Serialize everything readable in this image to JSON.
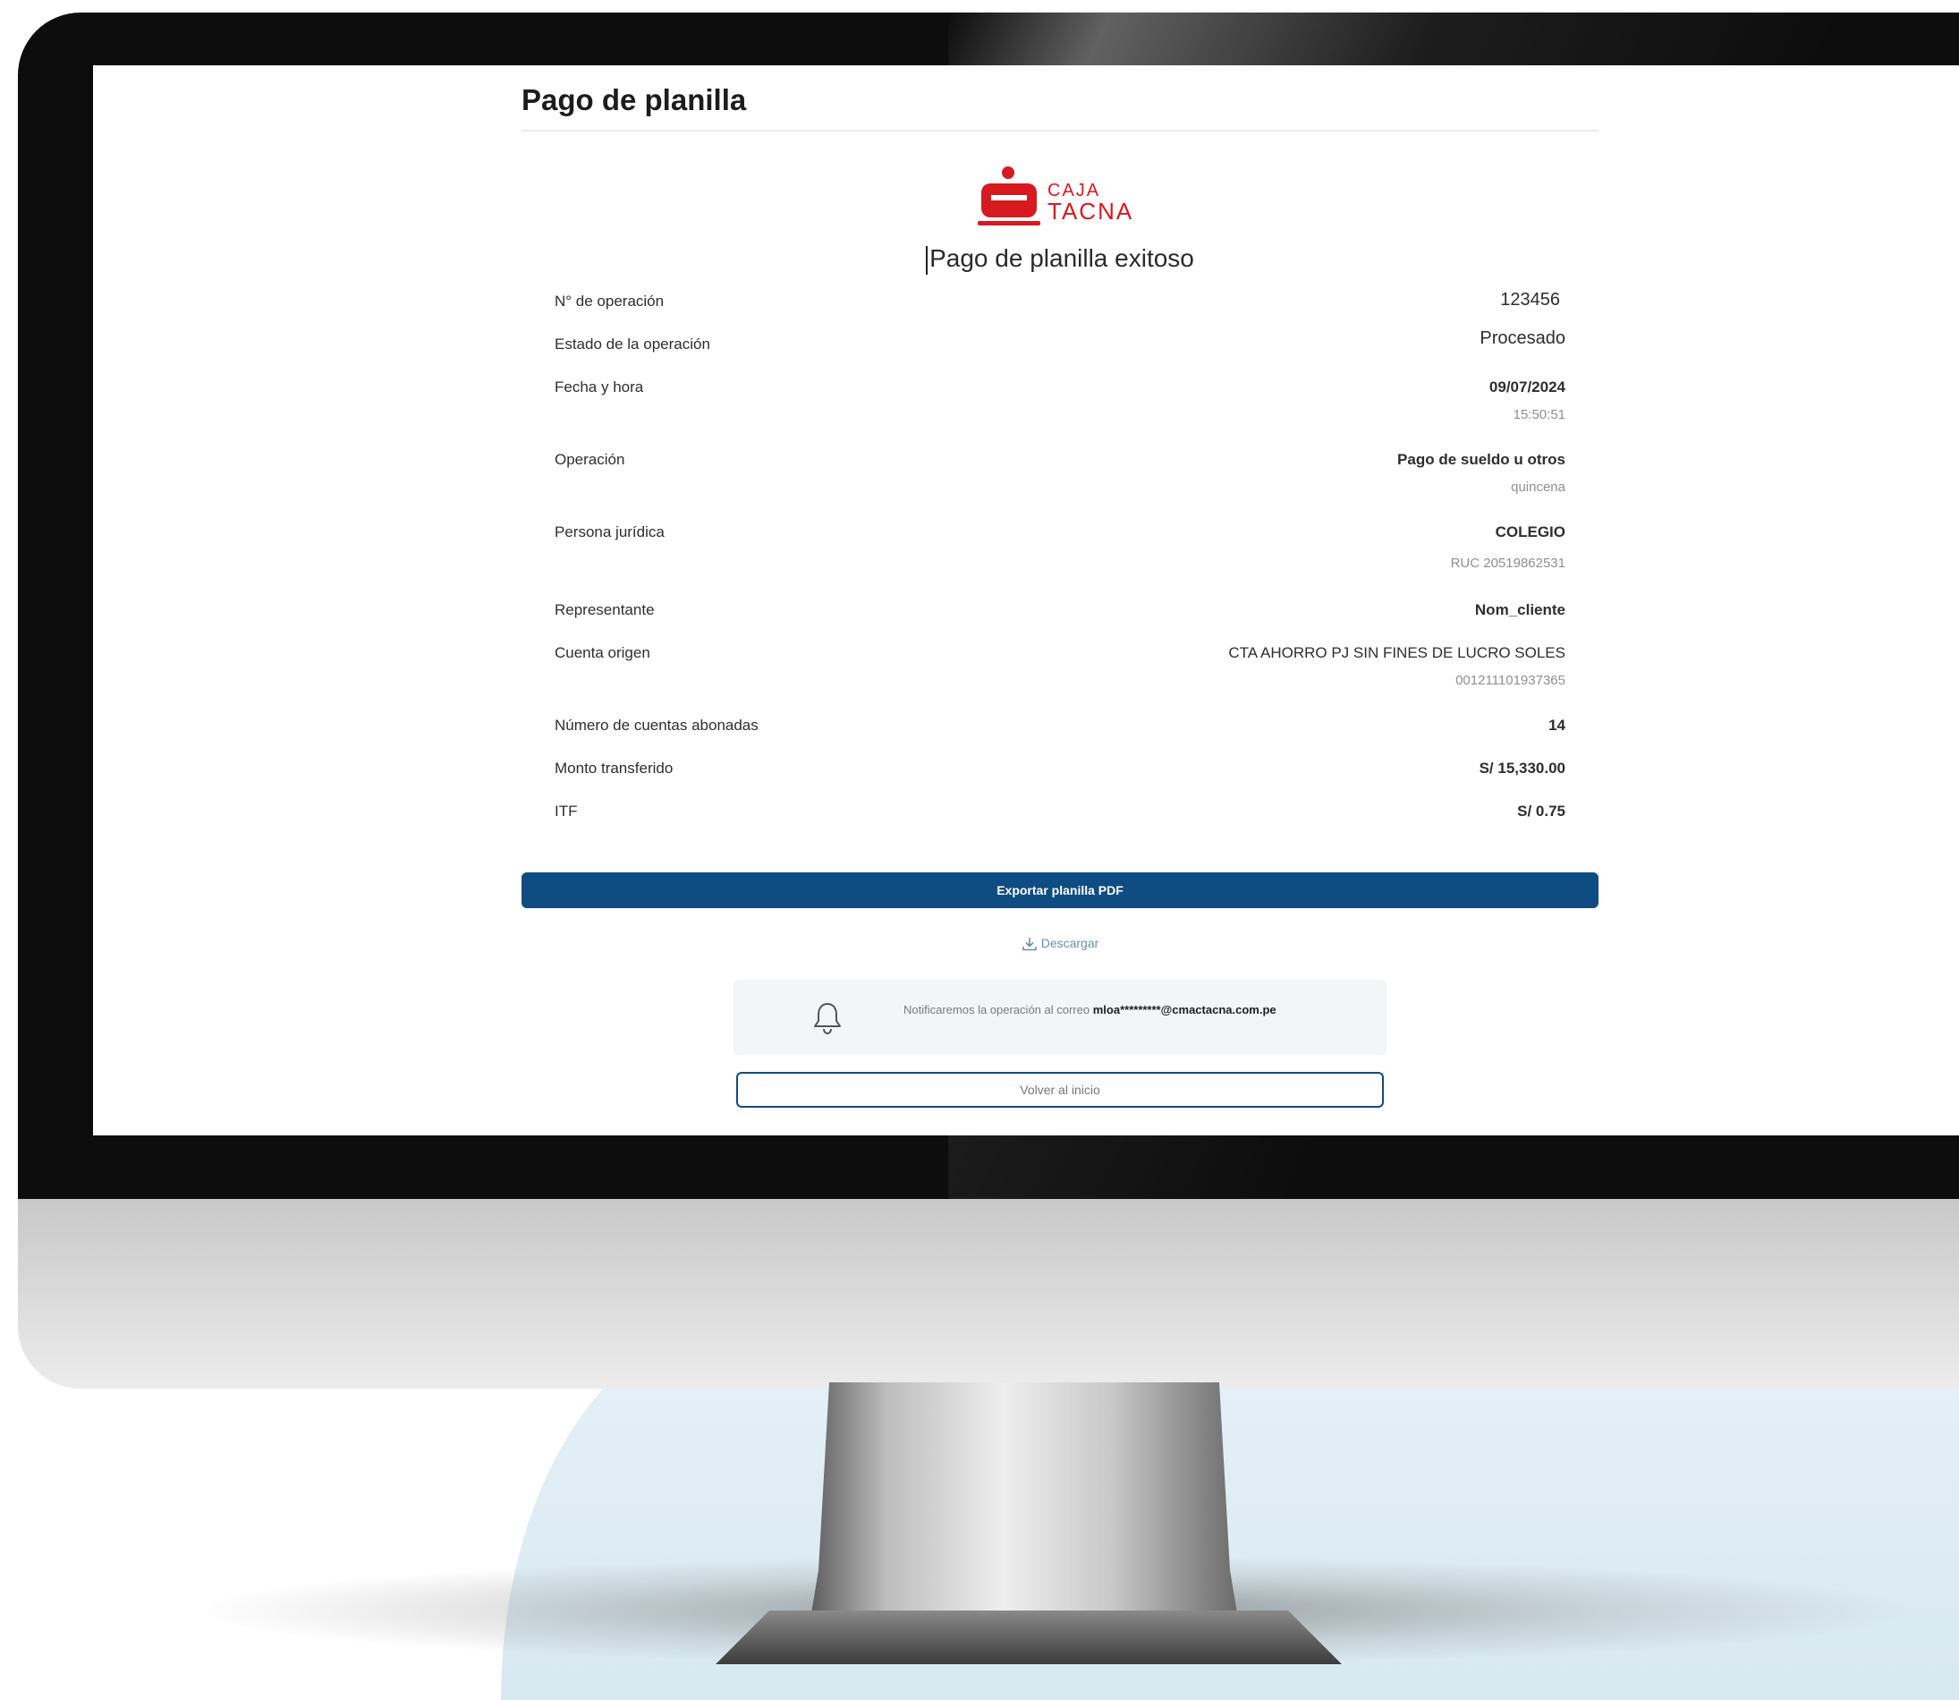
{
  "page": {
    "title": "Pago de planilla",
    "brand": {
      "line1": "CAJA",
      "line2": "TACNA",
      "color": "#d71920"
    },
    "success_title": "Pago de planilla exitoso"
  },
  "details": {
    "operation_number": {
      "label": "N° de operación",
      "value": "123456"
    },
    "status": {
      "label": "Estado de la operación",
      "value": "Procesado"
    },
    "datetime": {
      "label": "Fecha y hora",
      "date": "09/07/2024",
      "time": "15:50:51"
    },
    "operation": {
      "label": "Operación",
      "value": "Pago de sueldo u otros",
      "detail": "quincena"
    },
    "legal_entity": {
      "label": "Persona jurídica",
      "value": "COLEGIO",
      "detail": "RUC 20519862531"
    },
    "representative": {
      "label": "Representante",
      "value": "Nom_cliente"
    },
    "source_account": {
      "label": "Cuenta origen",
      "value": "CTA AHORRO PJ SIN FINES DE LUCRO SOLES",
      "detail": "001211101937365"
    },
    "credited_accounts": {
      "label": "Número de cuentas abonadas",
      "value": "14"
    },
    "amount": {
      "label": "Monto transferido",
      "value": "S/ 15,330.00"
    },
    "itf": {
      "label": "ITF",
      "value": "S/ 0.75"
    }
  },
  "actions": {
    "export_label": "Exportar planilla PDF",
    "download_label": "Descargar",
    "home_label": "Volver al inicio"
  },
  "notification": {
    "text": "Notificaremos la operación al correo",
    "email": "mloa*********@cmactacna.com.pe"
  },
  "colors": {
    "primary": "#0f4c81",
    "brand_red": "#d71920",
    "panel": "#f4f5f6"
  },
  "icons": [
    "bell-icon",
    "download-icon"
  ]
}
